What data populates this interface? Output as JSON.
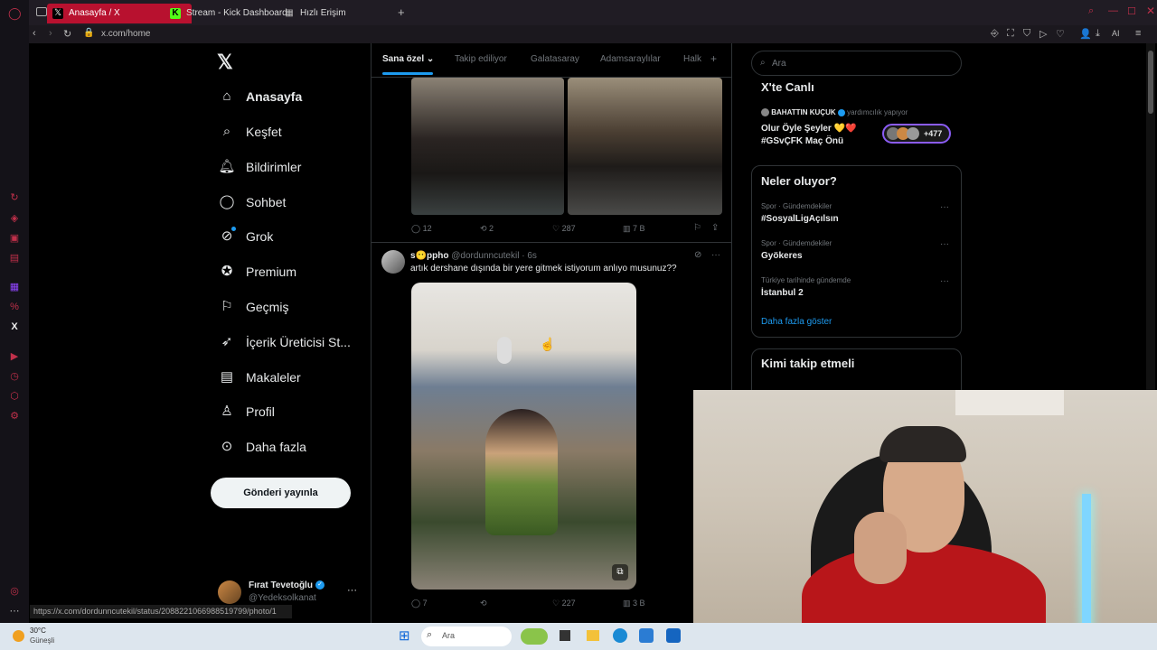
{
  "browser": {
    "tabs": [
      {
        "label": "Anasayfa / X"
      },
      {
        "label": "Stream - Kick Dashboard"
      },
      {
        "label": "Hızlı Erişim"
      }
    ],
    "url": "x.com/home",
    "ai_label": "AI"
  },
  "sidebar": {
    "items": [
      {
        "label": "Anasayfa",
        "icon": "home-icon"
      },
      {
        "label": "Keşfet",
        "icon": "search-icon"
      },
      {
        "label": "Bildirimler",
        "icon": "bell-icon"
      },
      {
        "label": "Sohbet",
        "icon": "chat-icon"
      },
      {
        "label": "Grok",
        "icon": "grok-icon"
      },
      {
        "label": "Premium",
        "icon": "verified-icon"
      },
      {
        "label": "Geçmiş",
        "icon": "bookmark-icon"
      },
      {
        "label": "İçerik Üreticisi St...",
        "icon": "rocket-icon"
      },
      {
        "label": "Makaleler",
        "icon": "article-icon"
      },
      {
        "label": "Profil",
        "icon": "person-icon"
      },
      {
        "label": "Daha fazla",
        "icon": "more-icon"
      }
    ],
    "post_button": "Gönderi yayınla",
    "account": {
      "name": "Fırat Tevetoğlu",
      "handle": "@Yedeksolkanat"
    }
  },
  "feed": {
    "tabs": [
      "Sana özel",
      "Takip ediliyor",
      "Galatasaray",
      "Adamsaraylılar",
      "Halk"
    ],
    "post1_actions": {
      "replies": "12",
      "reposts": "2",
      "likes": "287",
      "views": "7 B"
    },
    "post2": {
      "name": "s😶ppho",
      "handle": "@dordunncutekil",
      "time": "· 6s",
      "text": "artık dershane dışında bir yere gitmek istiyorum anlıyo musunuz??",
      "replies": "7",
      "likes": "227",
      "views": "3 B"
    }
  },
  "right": {
    "search_placeholder": "Ara",
    "live": {
      "title": "X'te Canlı",
      "host": "BAHATTIN KUÇUK",
      "host_sub": "yardımcılık yapıyor",
      "line1": "Olur Öyle Şeyler 💛❤️",
      "line2": "#GSvÇFK Maç Önü",
      "count": "+477"
    },
    "trends": {
      "title": "Neler oluyor?",
      "items": [
        {
          "cat": "Spor · Gündemdekiler",
          "name": "#SosyalLigAçılsın"
        },
        {
          "cat": "Spor · Gündemdekiler",
          "name": "Gyökeres"
        },
        {
          "cat": "Türkiye tarihinde gündemde",
          "name": "İstanbul 2"
        }
      ],
      "more": "Daha fazla göster"
    },
    "follow_title": "Kimi takip etmeli"
  },
  "statusbar_url": "https://x.com/dordunncutekil/status/2088221066988519799/photo/1",
  "taskbar": {
    "temp": "30°C",
    "weather": "Güneşli",
    "search": "Ara"
  },
  "colors": {
    "tab_active": "#b8112f",
    "accent": "#1d9bf0",
    "bg": "#000000"
  }
}
